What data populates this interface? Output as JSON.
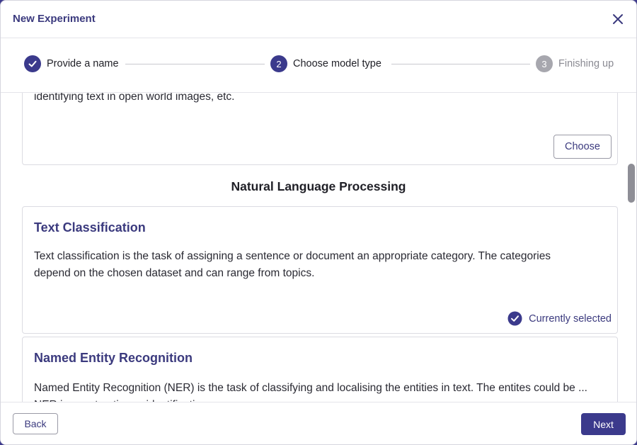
{
  "dialog": {
    "title": "New Experiment"
  },
  "stepper": {
    "steps": [
      {
        "number": "1",
        "label": "Provide a name",
        "state": "complete"
      },
      {
        "number": "2",
        "label": "Choose model type",
        "state": "active"
      },
      {
        "number": "3",
        "label": "Finishing up",
        "state": "pending"
      }
    ]
  },
  "content": {
    "prev_card": {
      "description": "identifying text in open world images, etc.",
      "choose_label": "Choose"
    },
    "section_title": "Natural Language Processing",
    "cards": [
      {
        "title": "Text Classification",
        "description": "Text classification is the task of assigning a sentence or document an appropriate category. The categories depend on the chosen dataset and can range from topics.",
        "selected_label": "Currently selected"
      },
      {
        "title": "Named Entity Recognition",
        "description": "Named Entity Recognition (NER) is the task of classifying and localising the entities in text. The entites could be ... NER is ... extraction ... identification"
      }
    ]
  },
  "footer": {
    "back_label": "Back",
    "next_label": "Next"
  },
  "colors": {
    "primary": "#3b3a8c",
    "pending": "#a7a7ae",
    "border": "#dcdce2"
  },
  "icons": {
    "close": "close-icon",
    "check": "check-icon"
  }
}
